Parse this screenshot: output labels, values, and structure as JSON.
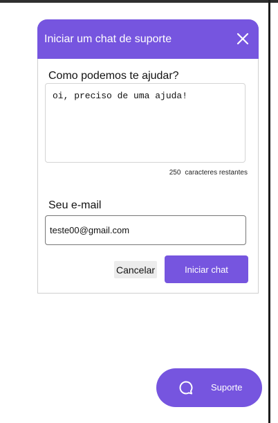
{
  "dialog": {
    "title": "Iniciar um chat de suporte",
    "close_icon": "close-icon",
    "help_label": "Como podemos te ajudar?",
    "message_value": "oi, preciso de uma ajuda!",
    "char_count": "250",
    "char_count_suffix": "caracteres restantes",
    "email_label": "Seu e-mail",
    "email_value": "teste00@gmail.com",
    "cancel_label": "Cancelar",
    "start_label": "Iniciar chat"
  },
  "support_fab": {
    "icon": "chat-bubble-icon",
    "label": "Suporte"
  },
  "colors": {
    "accent": "#7655df",
    "white": "#ffffff"
  }
}
